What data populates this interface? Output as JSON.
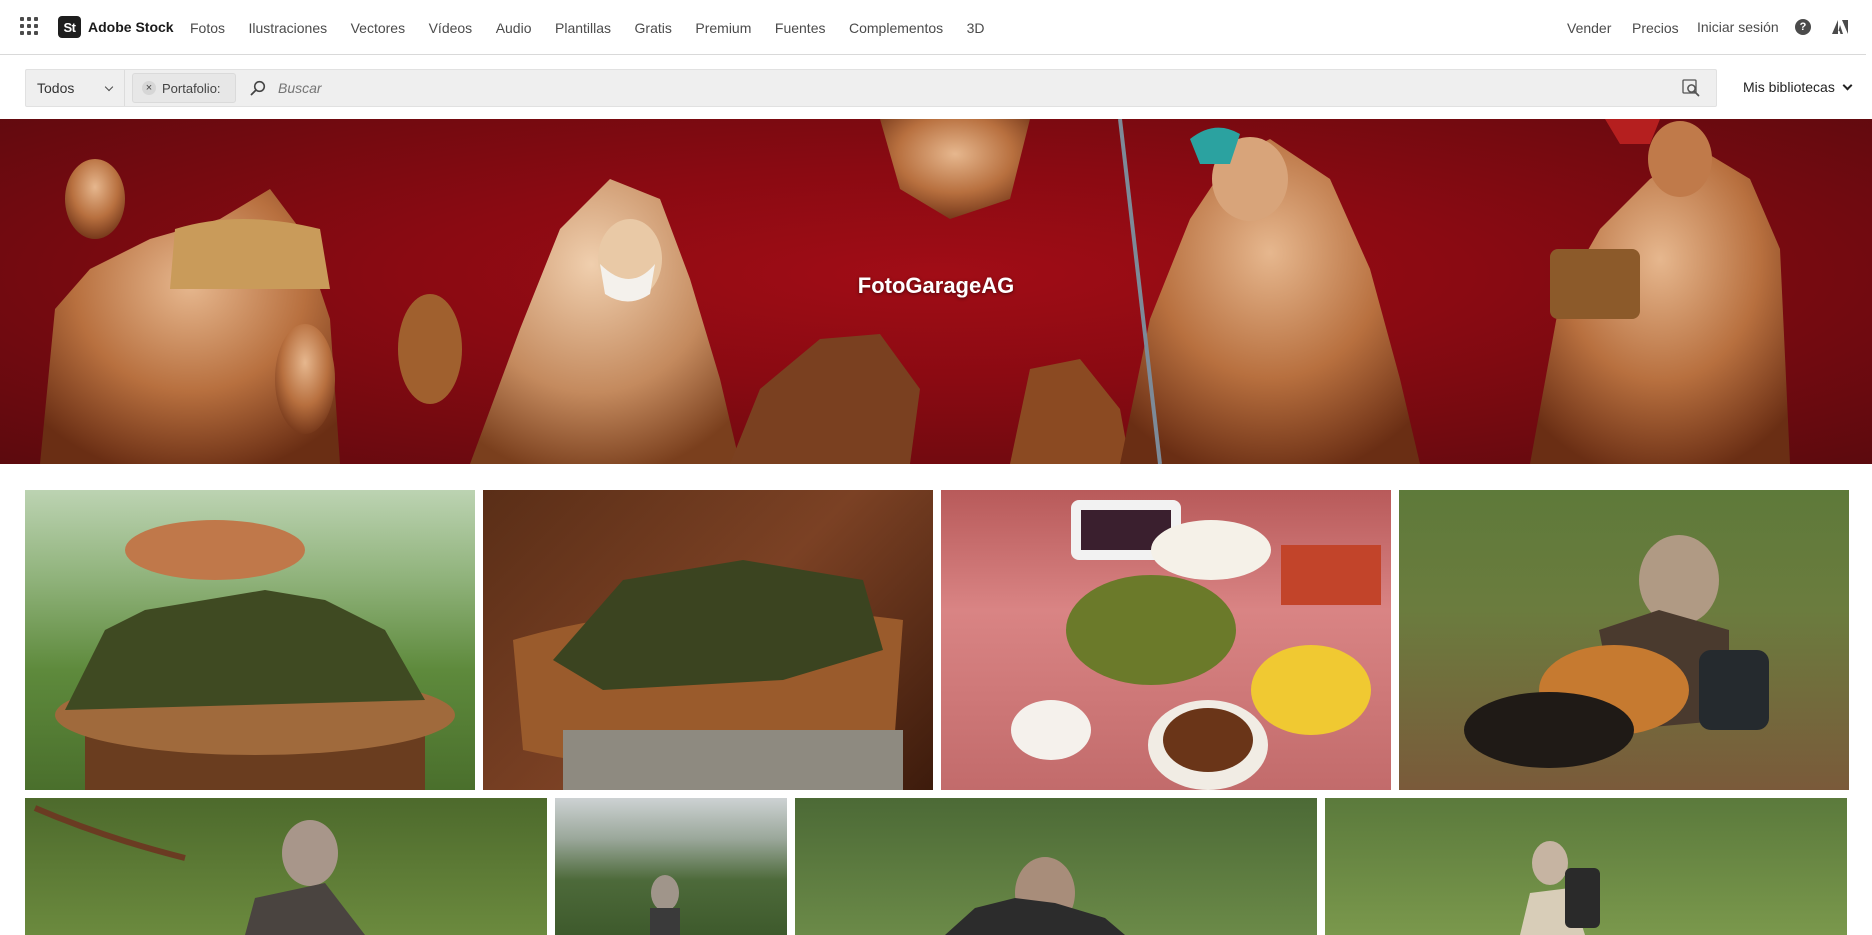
{
  "brand": {
    "badge": "St",
    "name": "Adobe Stock"
  },
  "nav": {
    "links": [
      "Fotos",
      "Ilustraciones",
      "Vectores",
      "Vídeos",
      "Audio",
      "Plantillas",
      "Gratis",
      "Premium",
      "Fuentes",
      "Complementos",
      "3D"
    ],
    "right": {
      "sell": "Vender",
      "pricing": "Precios",
      "signin": "Iniciar sesión",
      "help_glyph": "?"
    }
  },
  "search": {
    "filter": "Todos",
    "tag_label": "Portafolio:",
    "tag_close": "×",
    "placeholder": "Buscar",
    "libraries": "Mis bibliotecas"
  },
  "banner": {
    "title": "FotoGarageAG"
  },
  "colors": {
    "banner_red": "#a10d16",
    "nav_text": "#4b4b4b",
    "search_bg": "#efefef"
  },
  "icons": [
    "apps-grid-icon",
    "search-icon",
    "visual-search-icon",
    "help-icon",
    "adobe-logo-icon",
    "chevron-down-icon",
    "close-icon"
  ]
}
